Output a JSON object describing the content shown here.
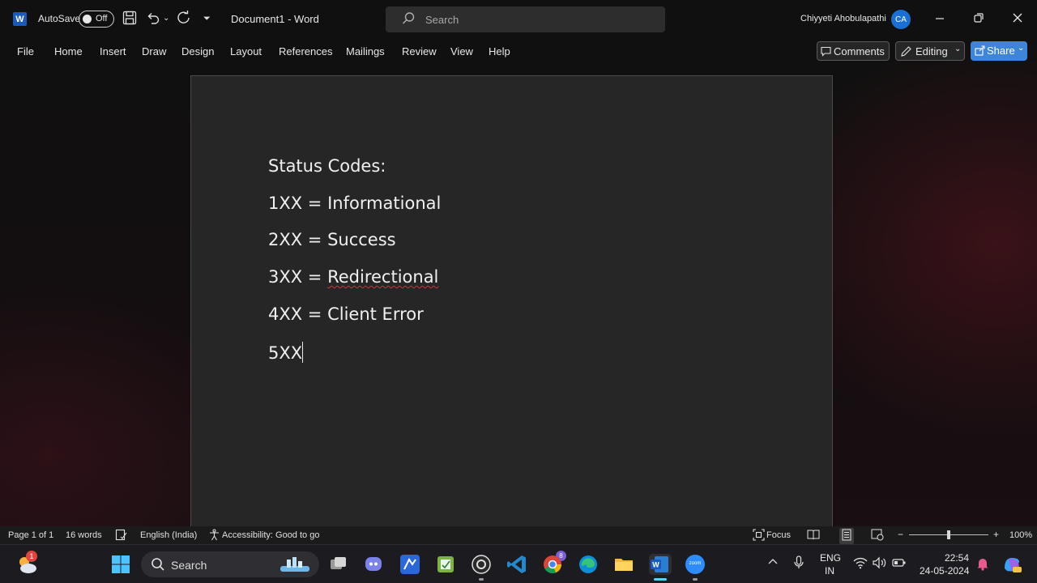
{
  "titlebar": {
    "app_logo_letter": "W",
    "autosave_label": "AutoSave",
    "autosave_state": "Off",
    "document_title": "Document1  -  Word",
    "search_placeholder": "Search",
    "user_name": "Chiyyeti Ahobulapathi",
    "avatar_initials": "CA"
  },
  "menu": {
    "items": [
      "File",
      "Home",
      "Insert",
      "Draw",
      "Design",
      "Layout",
      "References",
      "Mailings",
      "Review",
      "View",
      "Help"
    ],
    "comments_label": "Comments",
    "editing_label": "Editing",
    "share_label": "Share"
  },
  "document": {
    "lines": [
      "Status Codes:",
      "1XX = Informational",
      "2XX = Success",
      "3XX = ",
      "4XX = Client Error",
      "5XX"
    ],
    "misspelled_word": "Redirectional"
  },
  "statusbar": {
    "page": "Page 1 of 1",
    "words": "16 words",
    "language": "English (India)",
    "accessibility": "Accessibility: Good to go",
    "focus": "Focus",
    "zoom_minus": "−",
    "zoom_plus": "+",
    "zoom_level": "100%",
    "zoom_fraction": 0.5
  },
  "taskbar": {
    "search_label": "Search",
    "weather_badge": "1",
    "teams_badge": "8",
    "zoom_label": "zoom",
    "lang_line1": "ENG",
    "lang_line2": "IN",
    "time": "22:54",
    "date": "24-05-2024"
  },
  "colors": {
    "word_blue": "#185abd",
    "share_blue": "#3d85d8",
    "avatar_blue": "#1a6fd4",
    "page_bg": "#262626",
    "spell_red": "#d13438"
  }
}
